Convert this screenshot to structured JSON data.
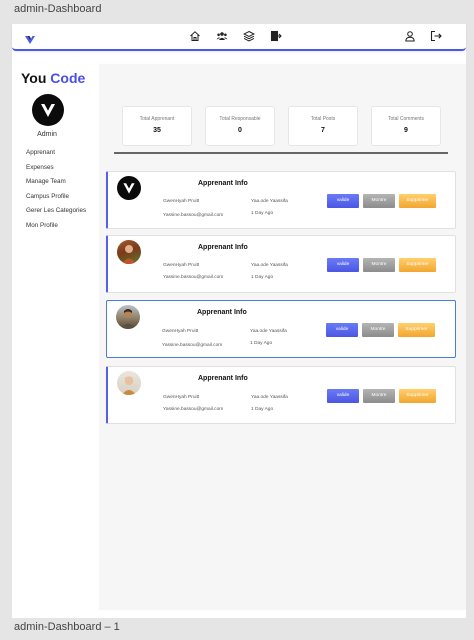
{
  "frame": {
    "title": "admin-Dashboard",
    "footer": "admin-Dashboard – 1"
  },
  "topbar": {
    "logo_icon": "v-logo-icon",
    "nav_icons": [
      "home-icon",
      "users-icon",
      "layers-icon",
      "export-icon"
    ],
    "right_icons": [
      "user-icon",
      "logout-icon"
    ],
    "accent": "#4a5ae8"
  },
  "sidebar": {
    "brand_you": "You",
    "brand_code": "Code",
    "admin_label": "Admin",
    "menu": [
      "Apprenant",
      "Expenses",
      "Manage Team",
      "Campus Profile",
      "Gerer Les Categories",
      "Mon Profile"
    ]
  },
  "stats": [
    {
      "label": "Total Apprenant",
      "value": "35"
    },
    {
      "label": "Total Responsable",
      "value": "0"
    },
    {
      "label": "Total Posts",
      "value": "7"
    },
    {
      "label": "Total Comments",
      "value": "9"
    }
  ],
  "cards": [
    {
      "title": "Apprenant Info",
      "name": "GwenHyah Pruitt",
      "email": "Yassine.bassou@gmail.com",
      "username": "Yaa.ode Yaassifa",
      "time": "1 Day Ago",
      "valide": "valide",
      "montrer": "Montre",
      "supprimer": "Supprimer",
      "avatar": "logo"
    },
    {
      "title": "Apprenant Info",
      "name": "GwenHyah Pruitt",
      "email": "Yassine.bassou@gmail.com",
      "username": "Yaa.ode Yaassifa",
      "time": "1 Day Ago",
      "valide": "valide",
      "montrer": "Montre",
      "supprimer": "Supprimer",
      "avatar": "photo"
    },
    {
      "title": "Apprenant Info",
      "name": "GwenHyah Pruitt",
      "email": "Yassine.bassou@gmail.com",
      "username": "Yaa.ode Yaassifa",
      "time": "1 Day Ago",
      "valide": "valide",
      "montrer": "Montre",
      "supprimer": "Supprimer",
      "avatar": "photo"
    },
    {
      "title": "Apprenant Info",
      "name": "GwenHyah Pruitt",
      "email": "Yassine.bassou@gmail.com",
      "username": "Yaa.ode Yaassifa",
      "time": "1 Day Ago",
      "valide": "valide",
      "montrer": "Montre",
      "supprimer": "Supprimer",
      "avatar": "photo"
    }
  ]
}
